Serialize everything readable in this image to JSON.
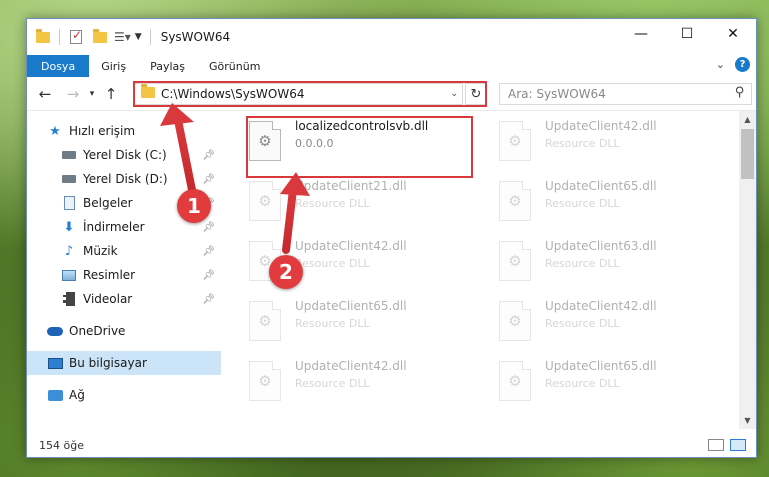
{
  "window": {
    "title": "SysWOW64",
    "controls": {
      "minimize": "—",
      "maximize": "☐",
      "close": "✕"
    }
  },
  "ribbon": {
    "tabs": [
      "Dosya",
      "Giriş",
      "Paylaş",
      "Görünüm"
    ],
    "help": "?"
  },
  "address": {
    "path": "C:\\Windows\\SysWOW64",
    "search_placeholder": "Ara: SysWOW64"
  },
  "sidebar": {
    "quick_access": "Hızlı erişim",
    "pinned": [
      "Yerel Disk (C:)",
      "Yerel Disk (D:)",
      "Belgeler",
      "İndirmeler",
      "Müzik",
      "Resimler",
      "Videolar"
    ],
    "onedrive": "OneDrive",
    "this_pc": "Bu bilgisayar",
    "network": "Ağ"
  },
  "files": {
    "highlighted": {
      "name": "localizedcontrolsvb.dll",
      "type": "0.0.0.0"
    },
    "background": [
      {
        "name": "UpdateClient42.dll",
        "type": "Resource DLL"
      },
      {
        "name": "UpdateClient21.dll",
        "type": "Resource DLL"
      },
      {
        "name": "UpdateClient65.dll",
        "type": "Resource DLL"
      },
      {
        "name": "UpdateClient42.dll",
        "type": "Resource DLL"
      },
      {
        "name": "UpdateClient63.dll",
        "type": "Resource DLL"
      },
      {
        "name": "UpdateClient65.dll",
        "type": "Resource DLL"
      },
      {
        "name": "UpdateClient42.dll",
        "type": "Resource DLL"
      },
      {
        "name": "UpdateClient42.dll",
        "type": "Resource DLL"
      },
      {
        "name": "UpdateClient65.dll",
        "type": "Resource DLL"
      }
    ]
  },
  "status": {
    "count": "154 öğe"
  },
  "annotations": {
    "marker1": "1",
    "marker2": "2",
    "accent": "#e23b3d"
  }
}
